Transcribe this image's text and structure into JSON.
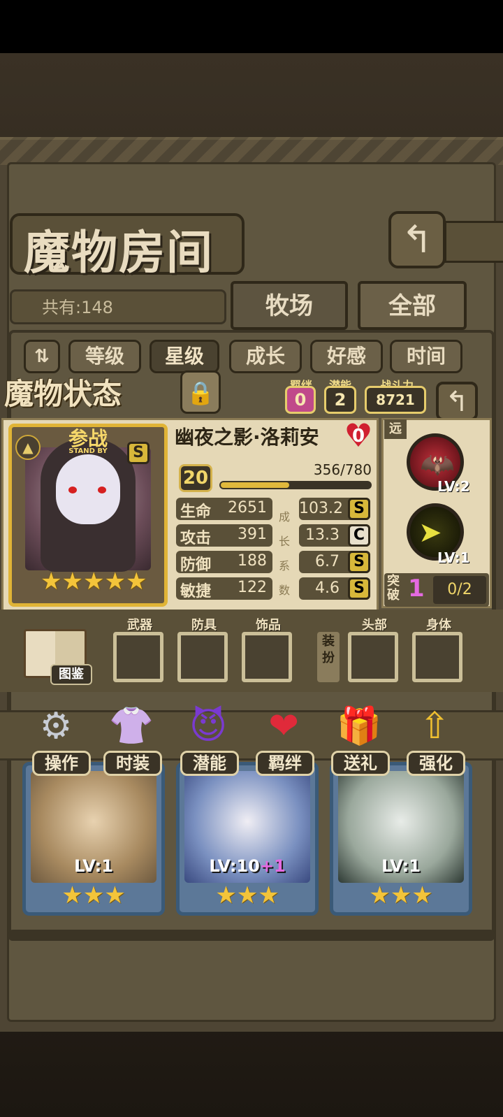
{
  "title": "魔物房间",
  "count_label": "共有:148",
  "filter_tabs": [
    "牧场",
    "全部"
  ],
  "sort_tabs": [
    {
      "label": "等级",
      "selected": false
    },
    {
      "label": "星级",
      "selected": true
    },
    {
      "label": "成长",
      "selected": false
    },
    {
      "label": "好感",
      "selected": false
    },
    {
      "label": "时间",
      "selected": false
    }
  ],
  "status_title": "魔物状态",
  "mini_stats": {
    "bond_label": "羁绊",
    "bond_value": "0",
    "potential_label": "潜能",
    "potential_value": "2",
    "power_label": "战斗力",
    "power_value": "8721"
  },
  "monster": {
    "standby_label": "参战",
    "standby_sub": "STAND BY",
    "rank": "S",
    "stars": 5,
    "name": "幽夜之影·洛莉安",
    "affection": "0",
    "level": "20",
    "xp_text": "356/780",
    "xp_fraction": 0.456
  },
  "stats": [
    {
      "label": "生命",
      "value": "2651",
      "growth": "103.2",
      "grade": "S"
    },
    {
      "label": "攻击",
      "value": "391",
      "growth": "13.3",
      "grade": "C"
    },
    {
      "label": "防御",
      "value": "188",
      "growth": "6.7",
      "grade": "S"
    },
    {
      "label": "敏捷",
      "value": "122",
      "growth": "4.6",
      "grade": "S"
    }
  ],
  "growth_label": "成长系数",
  "range_label": "远",
  "skills": [
    {
      "level": "LV:2"
    },
    {
      "level": "LV:1"
    }
  ],
  "breakthrough": {
    "label": "突破",
    "value": "1",
    "progress": "0/2"
  },
  "codex_label": "图鉴",
  "equipment_slots": [
    "武器",
    "防具",
    "饰品",
    "头部",
    "身体"
  ],
  "dress_label": "装扮",
  "actions": [
    "操作",
    "时装",
    "潜能",
    "羁绊",
    "送礼",
    "强化"
  ],
  "monster_cards": [
    {
      "level": "LV:1",
      "stars": 3
    },
    {
      "level": "LV:10",
      "bonus": "+1",
      "stars": 3
    },
    {
      "level": "LV:1",
      "stars": 3
    }
  ],
  "colors": {
    "accent_gold": "#e0b436",
    "panel_bg": "#e5d8b6",
    "dark_bg": "#5a5038"
  }
}
